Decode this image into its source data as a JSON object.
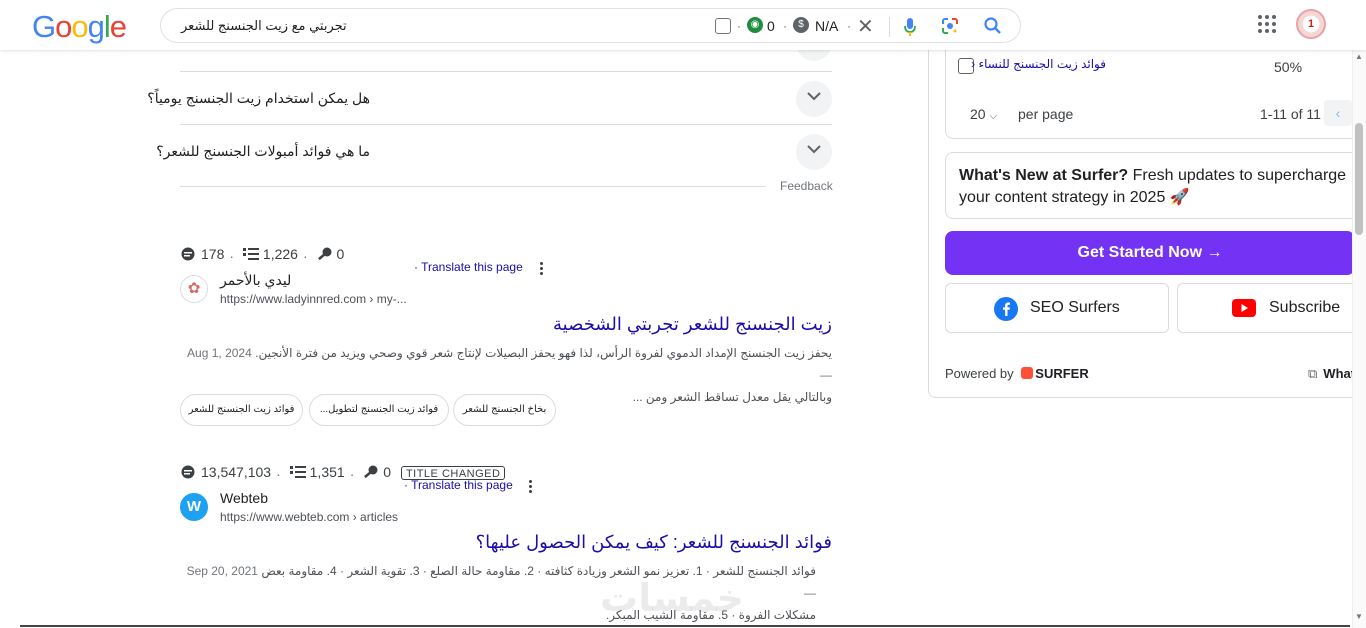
{
  "header": {
    "logo": [
      "G",
      "o",
      "o",
      "g",
      "l",
      "e"
    ],
    "query": "تجربتي مع زيت الجنسنج للشعر",
    "ext_metric_1": "0",
    "ext_metric_2": "N/A",
    "dot": "·"
  },
  "faq": {
    "items": [
      {
        "question": "هل يمكن استخدام زيت الجنسنج يومياً؟"
      },
      {
        "question": "ما هي فوائد أمبولات الجنسنج للشعر؟"
      }
    ],
    "feedback": "Feedback"
  },
  "results": [
    {
      "metrics": [
        "178",
        "1,226",
        "0"
      ],
      "site_name": "ليدي بالأحمر",
      "url": "https://www.ladyinnred.com › my-...",
      "translate": "Translate this page",
      "title": "زيت الجنسنج للشعر تجربتي الشخصية",
      "snippet_line1": "يحفز زيت الجنسنج الإمداد الدموي لفروة الرأس، لذا فهو يحفز البصيلات لإنتاج شعر قوي وصحي ويزيد من فترة الأنجين.",
      "date": "Aug 1, 2024 —",
      "snippet_line2": "وبالتالي يقل معدل تساقط الشعر ومن ...",
      "chips": [
        "فوائد زيت الجنسنج للشعر",
        "فوائد زيت الجنسنج لتطويل...",
        "بخاخ الجنسنج للشعر"
      ]
    },
    {
      "metrics": [
        "13,547,103",
        "1,351",
        "0"
      ],
      "badge": "TITLE CHANGED",
      "site_name": "Webteb",
      "favicon": "W",
      "url": "https://www.webteb.com › articles",
      "translate": "Translate this page",
      "title": "فوائد الجنسنج للشعر: كيف يمكن الحصول عليها؟",
      "snippet_line1": "فوائد الجنسنج للشعر · 1. تعزيز نمو الشعر وزيادة كثافته · 2. مقاومة حالة الصلع · 3. تقوية الشعر · 4. مقاومة بعض",
      "date": "Sep 20, 2021 —",
      "snippet_line2": "مشكلات الفروة · 5. مقاومة الشيب المبكر."
    }
  ],
  "sidebar": {
    "keyword_link": "فوائد زيت الجنسنج للنساء",
    "keyword_pct": "50%",
    "per_page_value": "20",
    "per_page_label": "per page",
    "range": "1-11 of 11",
    "news_bold": "What's New at Surfer?",
    "news_rest": " Fresh updates to supercharge",
    "news_line2": "your content strategy in 2025 🚀",
    "cta": "Get Started Now →",
    "social_1": "SEO Surfers",
    "social_2": "Subscribe",
    "powered_by": "Powered by",
    "brand": "SURFER",
    "what_link": "What"
  },
  "colors": {
    "link": "#1a0dab",
    "cta": "#7332f4",
    "facebook": "#1877f2",
    "youtube": "#ff0000"
  },
  "watermark": "خمسات"
}
